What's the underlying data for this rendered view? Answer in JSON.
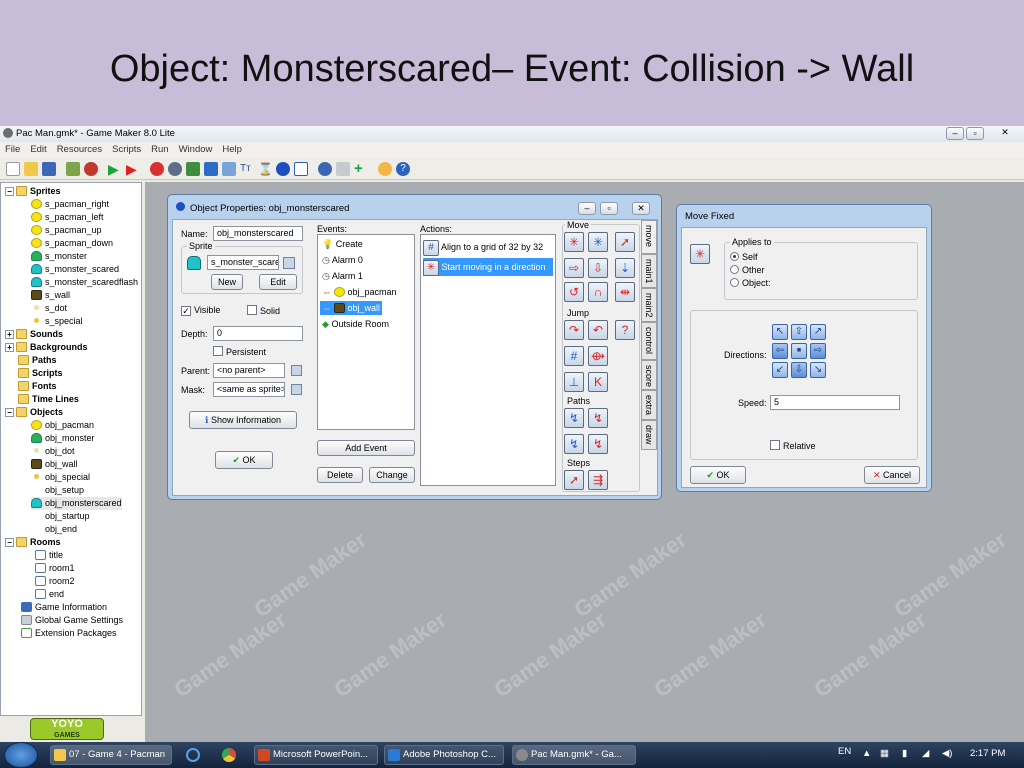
{
  "slide": {
    "title": "Object: Monsterscared– Event: Collision -> Wall"
  },
  "window": {
    "title": "Pac Man.gmk* - Game Maker 8.0 Lite"
  },
  "menu": [
    "File",
    "Edit",
    "Resources",
    "Scripts",
    "Run",
    "Window",
    "Help"
  ],
  "tree": {
    "sprites": "Sprites",
    "sprite_items": [
      "s_pacman_right",
      "s_pacman_left",
      "s_pacman_up",
      "s_pacman_down",
      "s_monster",
      "s_monster_scared",
      "s_monster_scaredflash",
      "s_wall",
      "s_dot",
      "s_special"
    ],
    "sounds": "Sounds",
    "backgrounds": "Backgrounds",
    "paths": "Paths",
    "scripts": "Scripts",
    "fonts": "Fonts",
    "timelines": "Time Lines",
    "objects": "Objects",
    "object_items": [
      "obj_pacman",
      "obj_monster",
      "obj_dot",
      "obj_wall",
      "obj_special",
      "obj_setup",
      "obj_monsterscared",
      "obj_startup",
      "obj_end"
    ],
    "rooms": "Rooms",
    "room_items": [
      "title",
      "room1",
      "room2",
      "end"
    ],
    "game_info": "Game Information",
    "global_settings": "Global Game Settings",
    "extensions": "Extension Packages"
  },
  "logo": {
    "top": "YOYO",
    "bottom": "GAMES"
  },
  "watermark": "Game Maker",
  "obj_props": {
    "title": "Object Properties: obj_monsterscared",
    "name_label": "Name:",
    "name_value": "obj_monsterscared",
    "sprite_label": "Sprite",
    "sprite_value": "s_monster_scarec",
    "new_btn": "New",
    "edit_btn": "Edit",
    "visible_label": "Visible",
    "solid_label": "Solid",
    "depth_label": "Depth:",
    "depth_value": "0",
    "persistent_label": "Persistent",
    "parent_label": "Parent:",
    "parent_value": "<no parent>",
    "mask_label": "Mask:",
    "mask_value": "<same as sprite>",
    "show_info_btn": "Show Information",
    "ok_btn": "OK",
    "events_label": "Events:",
    "events": [
      "Create",
      "Alarm 0",
      "Alarm 1",
      "obj_pacman",
      "obj_wall",
      "Outside Room"
    ],
    "add_event_btn": "Add Event",
    "delete_btn": "Delete",
    "change_btn": "Change",
    "actions_label": "Actions:",
    "actions": [
      "Align to a grid of 32 by 32",
      "Start moving in a direction"
    ],
    "groups": {
      "move": "Move",
      "jump": "Jump",
      "paths": "Paths",
      "steps": "Steps"
    },
    "tabs": [
      "move",
      "main1",
      "main2",
      "control",
      "score",
      "extra",
      "draw"
    ]
  },
  "move_fixed": {
    "title": "Move Fixed",
    "applies_to": "Applies to",
    "options": [
      "Self",
      "Other",
      "Object:"
    ],
    "directions_label": "Directions:",
    "speed_label": "Speed:",
    "speed_value": "5",
    "relative_label": "Relative",
    "ok_btn": "OK",
    "cancel_btn": "Cancel"
  },
  "taskbar": {
    "tasks": [
      "07 - Game 4 - Pacman",
      "Microsoft PowerPoin...",
      "Adobe Photoshop C...",
      "Pac Man.gmk* - Ga..."
    ],
    "lang": "EN",
    "time": "2:17 PM"
  }
}
